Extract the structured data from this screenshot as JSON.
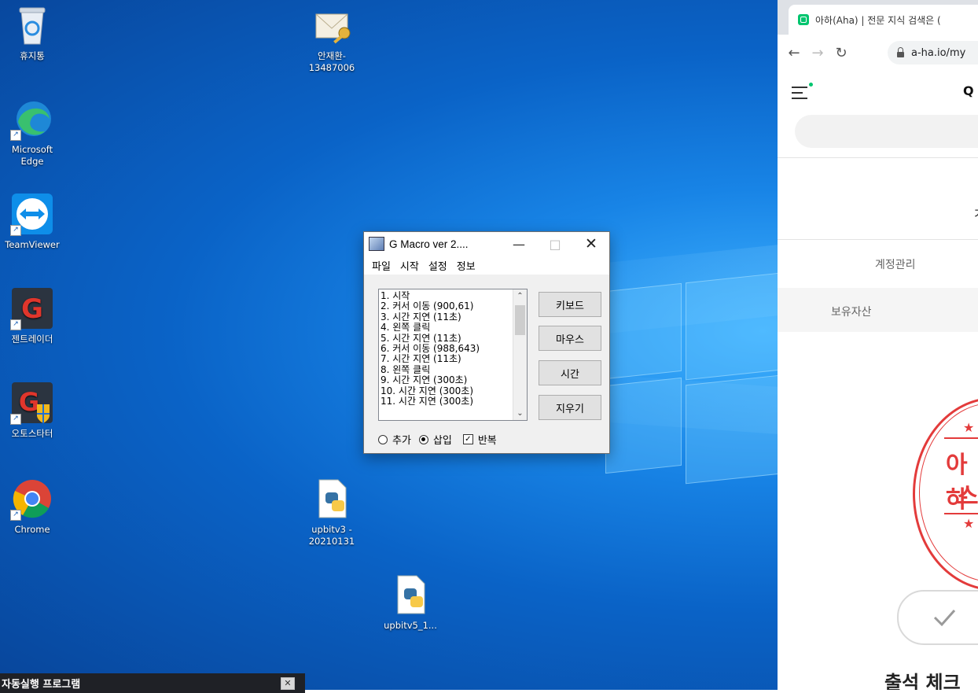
{
  "desktop": {
    "icons": [
      {
        "label": "휴지통",
        "icon": "recycle-bin-icon"
      },
      {
        "label": "안재환-\n13487006",
        "icon": "mail-key-icon"
      },
      {
        "label": "Microsoft\nEdge",
        "icon": "edge-icon"
      },
      {
        "label": "TeamViewer",
        "icon": "teamviewer-icon"
      },
      {
        "label": "젠트레이더",
        "icon": "g-trader-icon"
      },
      {
        "label": "오토스타터",
        "icon": "g-autostarter-icon"
      },
      {
        "label": "Chrome",
        "icon": "chrome-icon"
      },
      {
        "label": "upbitv3 -\n20210131",
        "icon": "python-file-icon"
      },
      {
        "label": "upbitv5_1...",
        "icon": "python-file-icon"
      }
    ]
  },
  "gmacro": {
    "title": "G Macro  ver 2....",
    "menu": [
      "파일",
      "시작",
      "설정",
      "정보"
    ],
    "list": [
      "1.  시작",
      "2.  커서 이동 (900,61)",
      "3.  시간 지연 (11초)",
      "4.  왼쪽 클릭",
      "5.  시간 지연 (11초)",
      "6.  커서 이동 (988,643)",
      "7.  시간 지연 (11초)",
      "8.  왼쪽 클릭",
      "9.  시간 지연 (300초)",
      "10.  시간 지연 (300초)",
      "11.  시간 지연 (300초)"
    ],
    "buttons": {
      "keyboard": "키보드",
      "mouse": "마우스",
      "time": "시간",
      "erase": "지우기"
    },
    "options": {
      "add": "추가",
      "insert": "삽입",
      "repeat": "반복",
      "insert_selected": true,
      "repeat_checked": true
    }
  },
  "browser": {
    "tab_title": "아하(Aha) | 전문 지식 검색은 (",
    "url": "a-ha.io/my",
    "account_menu": "계정관리",
    "holdings": "보유자산",
    "stamp_text_1": "아하",
    "stamp_text_2": "스",
    "checkin_title": "출석 체크",
    "accent_color": "#e33b3b",
    "brand_color": "#00c56f"
  },
  "notification": {
    "text": "자동실행 프로그램"
  }
}
